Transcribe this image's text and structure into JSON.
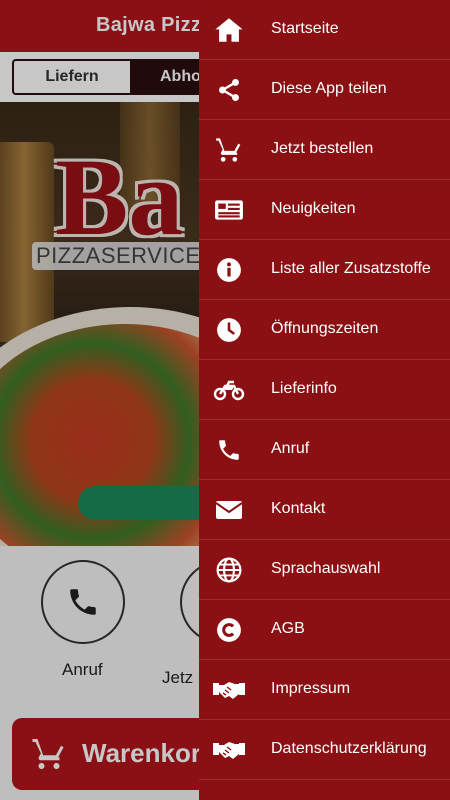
{
  "app": {
    "title": "Bajwa Pizza"
  },
  "mode_tabs": [
    {
      "label": "Liefern",
      "selected": false
    },
    {
      "label": "Abho",
      "selected": true
    }
  ],
  "hero": {
    "logo_text": "Ba",
    "subtitle": "PIZZASERVICE"
  },
  "actions": {
    "call_label": "Anruf",
    "order_label": "Jetz"
  },
  "cart": {
    "label": "Warenkorb"
  },
  "drawer": {
    "items": [
      {
        "label": "Startseite",
        "icon": "home-icon"
      },
      {
        "label": "Diese App teilen",
        "icon": "share-icon"
      },
      {
        "label": "Jetzt bestellen",
        "icon": "cart-icon"
      },
      {
        "label": "Neuigkeiten",
        "icon": "newspaper-icon"
      },
      {
        "label": "Liste aller Zusatzstoffe",
        "icon": "info-icon"
      },
      {
        "label": "Öffnungszeiten",
        "icon": "clock-icon"
      },
      {
        "label": "Lieferinfo",
        "icon": "motorcycle-icon"
      },
      {
        "label": "Anruf",
        "icon": "phone-icon"
      },
      {
        "label": "Kontakt",
        "icon": "envelope-icon"
      },
      {
        "label": "Sprachauswahl",
        "icon": "globe-icon"
      },
      {
        "label": "AGB",
        "icon": "copyright-icon"
      },
      {
        "label": "Impressum",
        "icon": "handshake-icon"
      },
      {
        "label": "Datenschutzerklärung",
        "icon": "handshake-icon"
      }
    ]
  },
  "colors": {
    "brand_red": "#b3151b",
    "drawer_red": "#8b1013",
    "tab_dark": "#2a0e10",
    "green_button": "#1a8a5a"
  }
}
